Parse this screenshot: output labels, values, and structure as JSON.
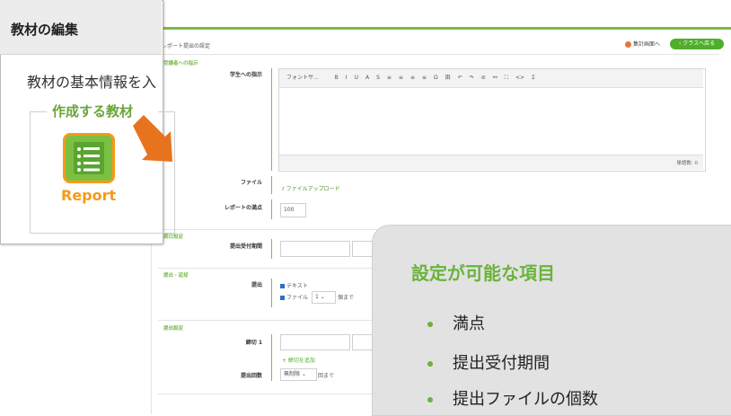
{
  "form": {
    "title": "レポート提出の設定",
    "summary_button": "集計画面へ",
    "back_button": "クラスへ戻る",
    "section_instructions": "受講者への指示",
    "student_instructions_label": "学生への指示",
    "toolbar_font": "フォントサ...",
    "toolbar_tools": [
      "B",
      "I",
      "U",
      "A",
      "S",
      "≡",
      "≡",
      "≡",
      "≡",
      "Ω",
      "田",
      "↶",
      "↷",
      "⊘",
      "⚯",
      "⛶",
      "<>",
      "Σ"
    ],
    "word_count": "単語数: 0",
    "file_label": "ファイル",
    "file_upload": "ファイルアップロード",
    "full_score_label": "レポートの満点",
    "full_score_value": "100",
    "section_deadline": "期日設定",
    "period_label": "提出受付期間",
    "section_submission": "提出・返却",
    "submit_label": "提出",
    "opt_text": "テキスト",
    "opt_file": "ファイル",
    "file_count": "1",
    "file_count_suffix": "個まで",
    "section_submit_settings": "提出設定",
    "deadline1_label": "締切 1",
    "add_deadline": "+ 締切を追加",
    "submit_count_label": "提出回数",
    "submit_count_value": "無制限",
    "submit_count_suffix": "回まで"
  },
  "panel": {
    "title": "教材の編集",
    "description": "教材の基本情報を入",
    "legend": "作成する教材",
    "report_label": "Report"
  },
  "callout": {
    "title": "設定が可能な項目",
    "items": [
      "満点",
      "提出受付期間",
      "提出ファイルの個数"
    ]
  },
  "colors": {
    "accent_green": "#6bb33c",
    "report_orange": "#f59a1a",
    "arrow_orange": "#e8731f"
  }
}
